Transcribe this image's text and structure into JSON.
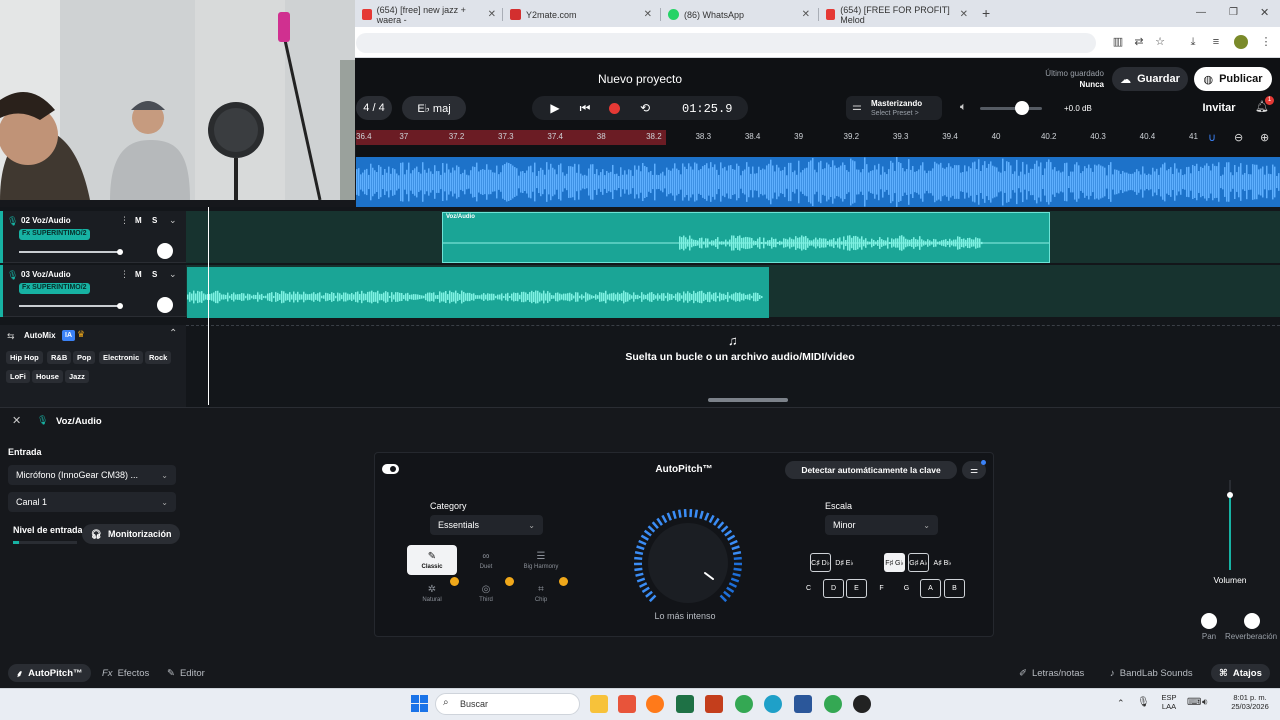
{
  "browser": {
    "tabs": [
      {
        "label": "(654) [free] new jazz + waera -",
        "color": "#e53935"
      },
      {
        "label": "Y2mate.com",
        "color": "#d32f2f"
      },
      {
        "label": "(86) WhatsApp",
        "color": "#25d366"
      },
      {
        "label": "(654) [FREE FOR PROFIT] Melod",
        "color": "#e53935"
      }
    ],
    "new_tab": "+"
  },
  "header": {
    "title": "Nuevo proyecto",
    "last_saved_label": "Último guardado",
    "last_saved_value": "Nunca",
    "save_button": "Guardar",
    "publish_button": "Publicar",
    "invite_button": "Invitar",
    "notif_count": "1"
  },
  "transport": {
    "time_sig": "4 / 4",
    "key": "E♭ maj",
    "timecode": "01:25.9",
    "mastering_label": "Masterizando",
    "preset_label": "Select Preset >",
    "volume_db": "+0.0 dB",
    "volume_level": 0.6
  },
  "ruler": {
    "ticks": [
      "36.4",
      "37",
      "37.2",
      "37.3",
      "37.4",
      "38",
      "38.2",
      "38.3",
      "38.4",
      "39",
      "39.2",
      "39.3",
      "39.4",
      "40",
      "40.2",
      "40.3",
      "40.4",
      "41"
    ]
  },
  "tracks": [
    {
      "name": "02  Voz/Audio",
      "fx": "Fx SUPERINTIMO/2",
      "mute": "M",
      "solo": "S",
      "clip_label": "Voz/Audio"
    },
    {
      "name": "03  Voz/Audio",
      "fx": "Fx SUPERINTIMO/2",
      "mute": "M",
      "solo": "S"
    }
  ],
  "drop_zone": "Suelta un bucle o un archivo audio/MIDI/video",
  "automix": {
    "label": "AutoMix",
    "badge": "IA",
    "genres": [
      "Hip Hop",
      "R&B",
      "Pop",
      "Electronic",
      "Rock",
      "LoFi",
      "House",
      "Jazz"
    ]
  },
  "panel": {
    "track_title": "Voz/Audio",
    "input_label": "Entrada",
    "input_device": "Micrófono (InnoGear CM38) ...",
    "channel": "Canal 1",
    "input_level_label": "Nivel de entrada",
    "monitor_button": "Monitorización",
    "autopitch_title": "AutoPitch™",
    "detect_key_button": "Detectar automáticamente la clave",
    "category_label": "Category",
    "category_value": "Essentials",
    "styles": [
      {
        "label": "Classic",
        "selected": true
      },
      {
        "label": "Duet"
      },
      {
        "label": "Big Harmony"
      },
      {
        "label": "Natural",
        "premium": true
      },
      {
        "label": "Third",
        "premium": true
      },
      {
        "label": "Chip",
        "premium": true
      }
    ],
    "knob_label": "Lo más intenso",
    "scale_label": "Escala",
    "scale_value": "Minor",
    "sharp_keys": [
      "C♯ D♭",
      "D♯ E♭",
      "F♯ G♭",
      "G♯ A♭",
      "A♯ B♭"
    ],
    "natural_keys": [
      "C",
      "D",
      "E",
      "F",
      "G",
      "A",
      "B"
    ],
    "volume_label": "Volumen",
    "pan_label": "Pan",
    "reverb_label": "Reverberación"
  },
  "bottom_bar": {
    "autopitch": "AutoPitch™",
    "effects": "Efectos",
    "editor": "Editor",
    "lyrics": "Letras/notas",
    "sounds": "BandLab Sounds",
    "shortcuts": "Atajos"
  },
  "taskbar": {
    "search_placeholder": "Buscar",
    "lang": "ESP",
    "lang_sub": "LAA",
    "time": "8:01 p. m.",
    "date": "25/03/2026"
  }
}
